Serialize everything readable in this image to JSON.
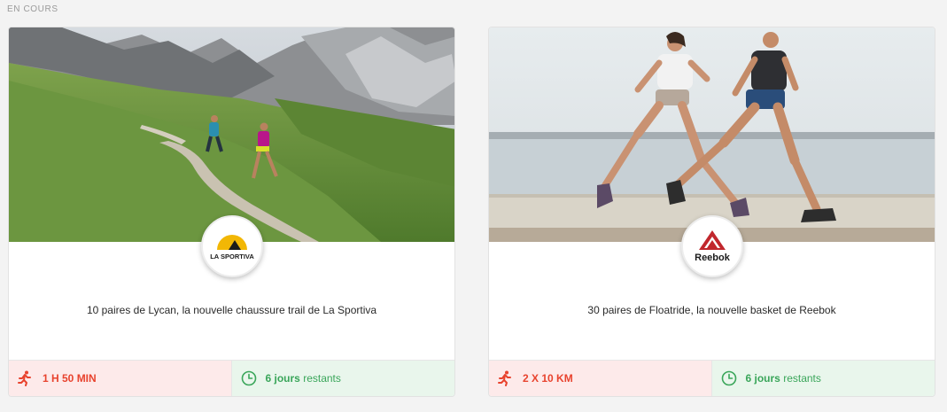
{
  "section": {
    "label": "EN COURS"
  },
  "cards": [
    {
      "brand": "La Sportiva",
      "logo_text": "LA SPORTIVA",
      "title": "10 paires de Lycan, la nouvelle chaussure trail de La Sportiva",
      "effort": "1 H 50 MIN",
      "days_count": "6 jours",
      "days_suffix": "restants",
      "icons": {
        "effort": "runner-icon",
        "time": "clock-icon"
      }
    },
    {
      "brand": "Reebok",
      "logo_text": "Reebok",
      "title": "30 paires de Floatride, la nouvelle basket de Reebok",
      "effort": "2 X 10 KM",
      "days_count": "6 jours",
      "days_suffix": "restants",
      "icons": {
        "effort": "runner-icon",
        "time": "clock-icon"
      }
    }
  ],
  "colors": {
    "effort_text": "#e8432e",
    "effort_bg": "#fdeaea",
    "time_text": "#3aa65a",
    "time_bg": "#e9f6ec",
    "sportiva_yellow": "#f2b705",
    "reebok_red": "#c1272d"
  }
}
